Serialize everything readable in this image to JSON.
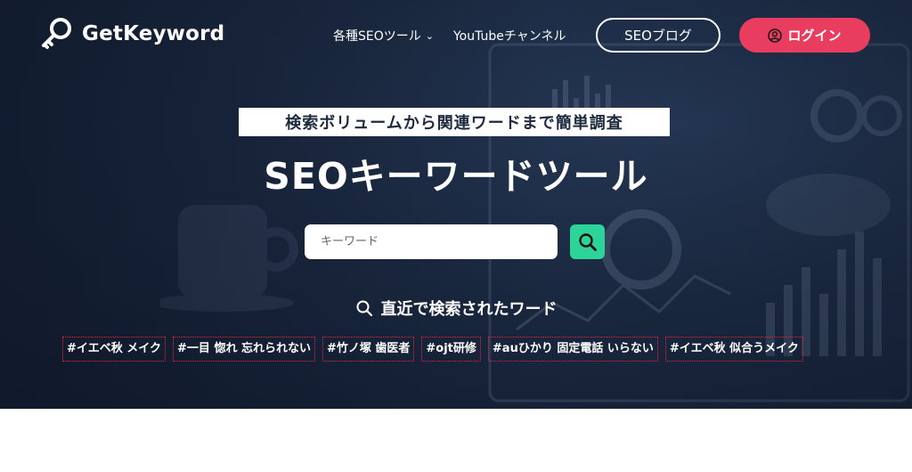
{
  "brand": {
    "name": "GetKeyword",
    "logo_icon": "key-icon"
  },
  "nav": {
    "items": [
      {
        "label": "各種SEOツール",
        "icon": "chevron-down-icon"
      },
      {
        "label": "YouTubeチャンネル"
      }
    ],
    "blog_button": "SEOブログ",
    "login_button": "ログイン",
    "login_icon": "user-circle-icon"
  },
  "hero": {
    "tagline": "検索ボリュームから関連ワードまで簡単調査",
    "title": "SEOキーワードツール",
    "search": {
      "placeholder": "キーワード",
      "button_icon": "search-icon"
    },
    "recent_heading": "直近で検索されたワード",
    "recent_tags": [
      "#イエベ秋 メイク",
      "#一目 惚れ 忘れられない",
      "#竹ノ塚 歯医者",
      "#ojt研修",
      "#auひかり 固定電話 いらない",
      "#イエベ秋 似合うメイク"
    ]
  },
  "colors": {
    "login_bg": "#e83d5f",
    "search_button_bg": "#2dd49a",
    "hero_bg": "#1c2b44",
    "tag_border": "#e8273f"
  }
}
